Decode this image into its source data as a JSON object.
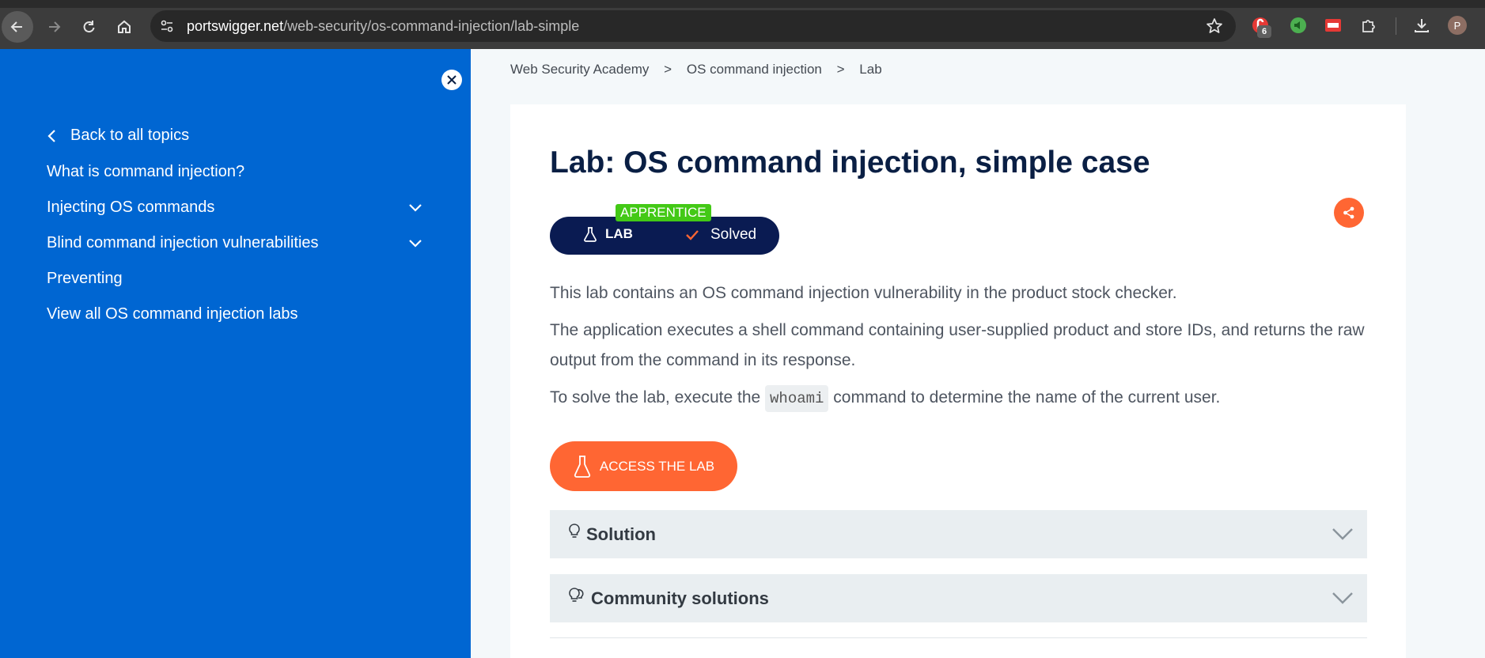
{
  "browser": {
    "url_host": "portswigger.net",
    "url_path": "/web-security/os-command-injection/lab-simple",
    "extension_badge": "6",
    "profile_initial": "P"
  },
  "sidebar": {
    "back_label": "Back to all topics",
    "items": [
      {
        "label": "What is command injection?",
        "expandable": false
      },
      {
        "label": "Injecting OS commands",
        "expandable": true
      },
      {
        "label": "Blind command injection vulnerabilities",
        "expandable": true
      },
      {
        "label": "Preventing",
        "expandable": false
      },
      {
        "label": "View all OS command injection labs",
        "expandable": false
      }
    ]
  },
  "breadcrumb": [
    {
      "label": "Web Security Academy"
    },
    {
      "separator": ">"
    },
    {
      "label": "OS command injection"
    },
    {
      "separator": ">"
    },
    {
      "label": "Lab"
    }
  ],
  "main": {
    "title": "Lab: OS command injection, simple case",
    "level_badge": "APPRENTICE",
    "lab_label": "LAB",
    "status_label": "Solved",
    "paragraph1": "This lab contains an OS command injection vulnerability in the product stock checker.",
    "paragraph2": "The application executes a shell command containing user-supplied product and store IDs, and returns the raw output from the command in its response.",
    "paragraph3_before": "To solve the lab, execute the ",
    "paragraph3_code": "whoami",
    "paragraph3_after": " command to determine the name of the current user.",
    "access_button": "ACCESS THE LAB",
    "accordions": [
      {
        "label": "Solution",
        "icon": "lightbulb-icon"
      },
      {
        "label": "Community solutions",
        "icon": "lightbulbs-icon"
      }
    ]
  },
  "colors": {
    "sidebar_bg": "#0066d2",
    "title": "#0a1f44",
    "badge_navy": "#0a1b52",
    "apprentice_green": "#43c916",
    "accent_orange": "#ff6633"
  }
}
